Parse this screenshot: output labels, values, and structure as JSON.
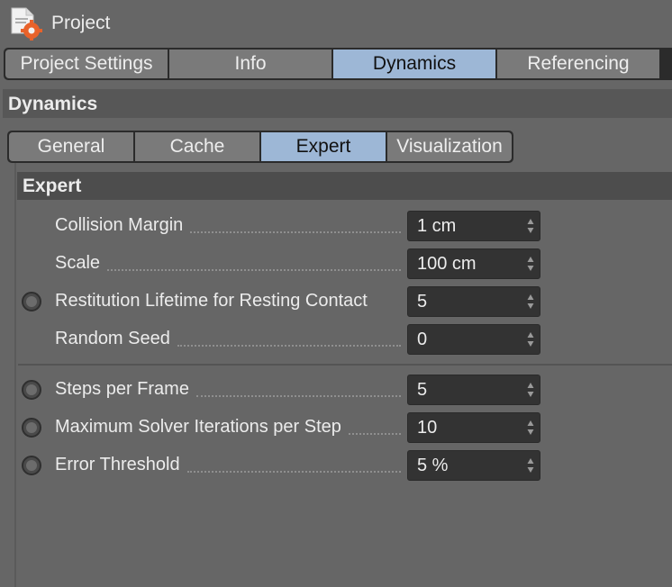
{
  "window": {
    "title": "Project",
    "icon": "project-gear-icon"
  },
  "main_tabs": [
    {
      "label": "Project Settings",
      "active": false
    },
    {
      "label": "Info",
      "active": false
    },
    {
      "label": "Dynamics",
      "active": true
    },
    {
      "label": "Referencing",
      "active": false
    }
  ],
  "section": {
    "title": "Dynamics"
  },
  "sub_tabs": [
    {
      "label": "General",
      "active": false
    },
    {
      "label": "Cache",
      "active": false
    },
    {
      "label": "Expert",
      "active": true
    },
    {
      "label": "Visualization",
      "active": false
    }
  ],
  "group": {
    "title": "Expert"
  },
  "fields": [
    {
      "label": "Collision Margin",
      "value": "1 cm",
      "radio": false
    },
    {
      "label": "Scale",
      "value": "100 cm",
      "radio": false
    },
    {
      "label": "Restitution Lifetime for Resting Contact",
      "value": "5",
      "radio": true
    },
    {
      "label": "Random Seed",
      "value": "0",
      "radio": false
    },
    {
      "label": "Steps per Frame",
      "value": "5",
      "radio": true
    },
    {
      "label": "Maximum Solver Iterations per Step",
      "value": "10",
      "radio": true
    },
    {
      "label": "Error Threshold",
      "value": "5 %",
      "radio": true
    }
  ],
  "colors": {
    "background": "#666666",
    "active_tab": "#9db7d6",
    "tab": "#7a7a7a",
    "field": "#333333"
  }
}
